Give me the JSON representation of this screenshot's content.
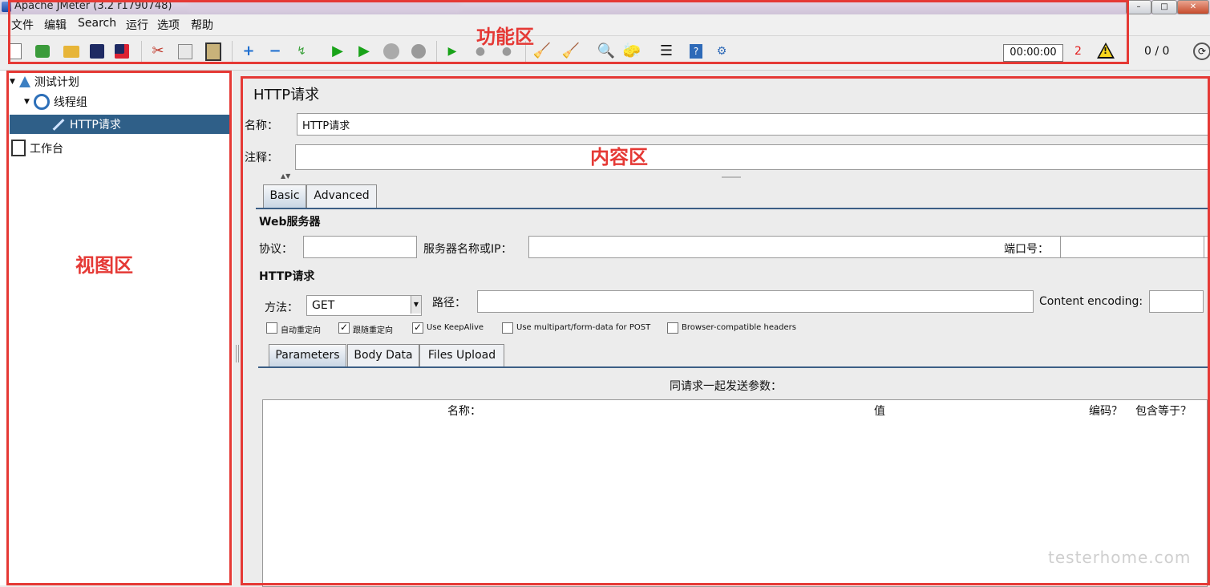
{
  "window": {
    "title": "Apache JMeter (3.2 r1790748)",
    "controls": [
      "–",
      "□",
      "✕"
    ]
  },
  "menubar": [
    "文件",
    "编辑",
    "Search",
    "运行",
    "选项",
    "帮助"
  ],
  "toolbar": {
    "timer": "00:00:00",
    "error_count": "2",
    "threads": "0 / 0",
    "icons": [
      "new-icon",
      "templates-icon",
      "open-icon",
      "save-icon",
      "save-as-icon",
      "cut-icon",
      "copy-icon",
      "paste-icon",
      "expand-icon",
      "collapse-icon",
      "toggle-icon",
      "start-icon",
      "start-no-pause-icon",
      "stop-icon",
      "shutdown-icon",
      "remote-start-icon",
      "remote-stop-icon",
      "remote-shutdown-icon",
      "clear-icon",
      "clear-all-icon",
      "search-icon",
      "reset-search-icon",
      "function-helper-icon",
      "help-icon",
      "log-viewer-icon"
    ]
  },
  "tree": {
    "items": [
      {
        "label": "测试计划",
        "level": 0,
        "icon": "test-plan-icon"
      },
      {
        "label": "线程组",
        "level": 1,
        "icon": "thread-group-icon"
      },
      {
        "label": "HTTP请求",
        "level": 2,
        "icon": "http-sampler-icon",
        "selected": true
      },
      {
        "label": "工作台",
        "level": 0,
        "icon": "workbench-icon"
      }
    ]
  },
  "content": {
    "heading": "HTTP请求",
    "name_label": "名称：",
    "name_value": "HTTP请求",
    "comment_label": "注释：",
    "comment_value": "",
    "tabs": [
      "Basic",
      "Advanced"
    ],
    "web_server": {
      "section_title": "Web服务器",
      "protocol_label": "协议：",
      "protocol_value": "",
      "server_label": "服务器名称或IP：",
      "server_value": "",
      "port_label": "端口号：",
      "port_value": ""
    },
    "http_request": {
      "section_title": "HTTP请求",
      "method_label": "方法：",
      "method_value": "GET",
      "path_label": "路径：",
      "path_value": "",
      "encoding_label": "Content encoding:",
      "encoding_value": ""
    },
    "checkboxes": [
      {
        "label": "自动重定向",
        "checked": false
      },
      {
        "label": "跟随重定向",
        "checked": true
      },
      {
        "label": "Use KeepAlive",
        "checked": true
      },
      {
        "label": "Use multipart/form-data for POST",
        "checked": false
      },
      {
        "label": "Browser-compatible headers",
        "checked": false
      }
    ],
    "param_tabs": [
      "Parameters",
      "Body Data",
      "Files Upload"
    ],
    "params_caption": "同请求一起发送参数：",
    "params_columns": [
      "名称：",
      "值",
      "编码？",
      "包含等于？"
    ]
  },
  "annotations": {
    "function_area": "功能区",
    "view_area": "视图区",
    "content_area": "内容区",
    "accent": "#e53935"
  },
  "watermark": "testerhome.com"
}
